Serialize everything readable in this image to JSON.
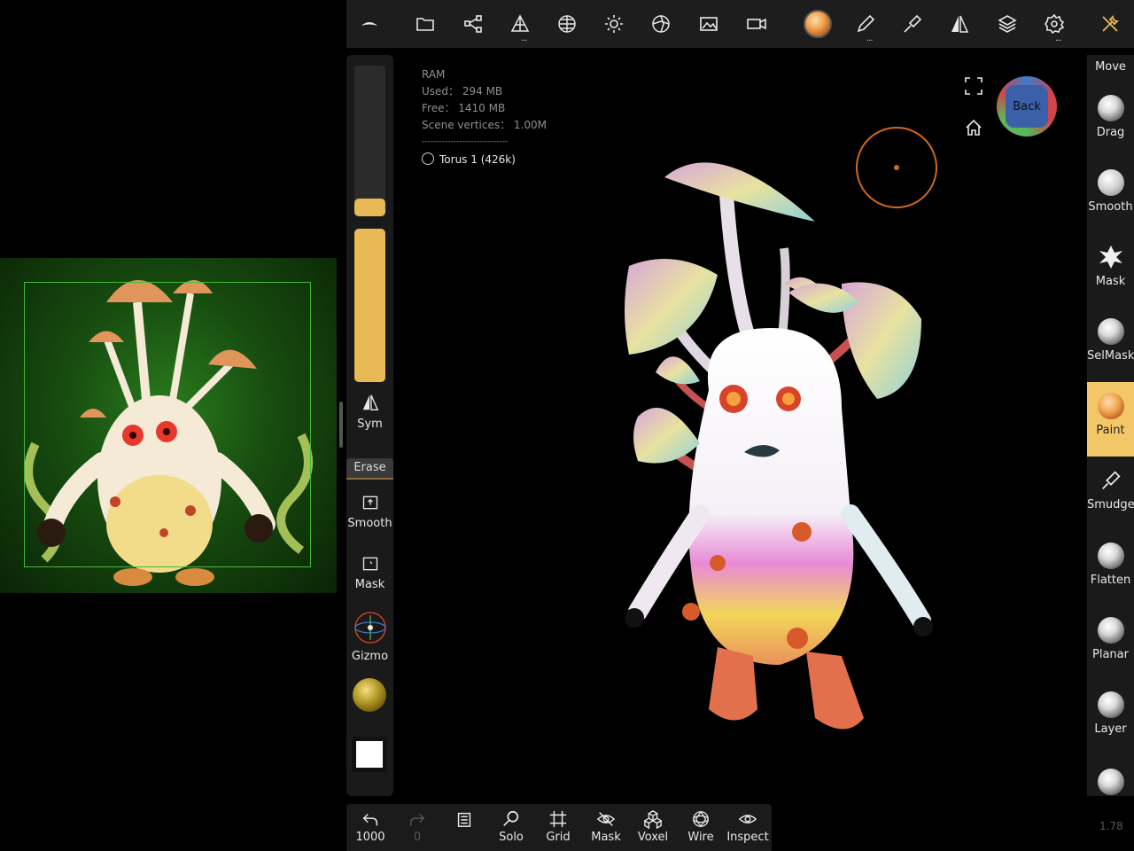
{
  "toolbar": {
    "items": [
      "logo",
      "files",
      "scene",
      "topology",
      "multires",
      "lighting",
      "materials",
      "background",
      "camera",
      "paint-preview",
      "brush-settings",
      "stroke",
      "symmetry",
      "layers",
      "settings",
      "tools"
    ]
  },
  "stats": {
    "ram_label": "RAM",
    "used": "Used： 294 MB",
    "free": "Free： 1410 MB",
    "vertices": "Scene vertices： 1.00M",
    "separator": "------------------------------",
    "object": "Torus 1 (426k)"
  },
  "left_tools": {
    "sym": "Sym",
    "erase": "Erase",
    "smooth": "Smooth",
    "mask": "Mask",
    "gizmo": "Gizmo",
    "radius_level": 0.08,
    "intensity_level": 1.0
  },
  "right_tools": {
    "move": "Move",
    "drag": "Drag",
    "smooth": "Smooth",
    "mask": "Mask",
    "selmask": "SelMask",
    "paint": "Paint",
    "smudge": "Smudge",
    "flatten": "Flatten",
    "planar": "Planar",
    "layer": "Layer"
  },
  "bottom": {
    "undo_count": "1000",
    "redo_count": "0",
    "solo": "Solo",
    "grid": "Grid",
    "mask": "Mask",
    "voxel": "Voxel",
    "wire": "Wire",
    "inspect": "Inspect"
  },
  "view_cube": {
    "face": "Back"
  },
  "version": "1.78",
  "colors": {
    "accent": "#e9b956",
    "paint_selected_bg": "#f3c768",
    "cursor": "#d06a1a"
  }
}
